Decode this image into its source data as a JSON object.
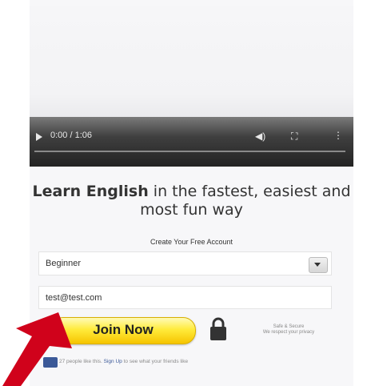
{
  "video": {
    "time": "0:00 / 1:06"
  },
  "headline": {
    "bold": "Learn English",
    "rest": " in the fastest, easiest and most fun way"
  },
  "form": {
    "subtitle": "Create Your Free Account",
    "level_value": "Beginner",
    "email_value": "test@test.com",
    "join_label": "Join Now"
  },
  "secure": {
    "title": "Safe & Secure",
    "subtitle": "We respect your privacy"
  },
  "facebook": {
    "pre": "27 people like this. ",
    "link": "Sign Up",
    "post": " to see what your friends like"
  },
  "colors": {
    "join_yellow": "#ffeb3b",
    "arrow_red": "#d0021b",
    "fb_blue": "#3b5998"
  }
}
